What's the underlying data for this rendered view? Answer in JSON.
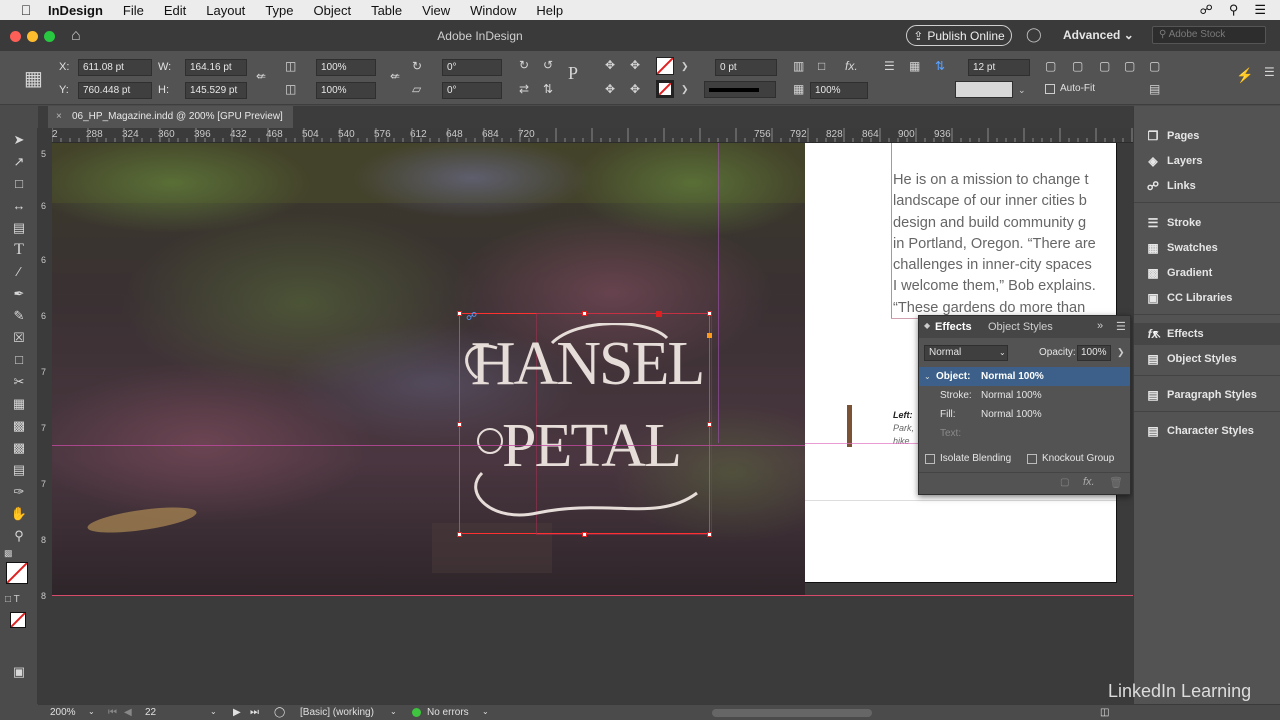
{
  "menubar": {
    "app": "InDesign",
    "items": [
      "File",
      "Edit",
      "Layout",
      "Type",
      "Object",
      "Table",
      "View",
      "Window",
      "Help"
    ]
  },
  "window": {
    "title": "Adobe InDesign",
    "publish_label": "Publish Online",
    "workspace": "Advanced",
    "search_placeholder": "Adobe Stock"
  },
  "control": {
    "x_label": "X:",
    "x_value": "611.08 pt",
    "y_label": "Y:",
    "y_value": "760.448 pt",
    "w_label": "W:",
    "w_value": "164.16 pt",
    "h_label": "H:",
    "h_value": "145.529 pt",
    "scale_x": "100%",
    "scale_y": "100%",
    "rotate": "0°",
    "shear": "0°",
    "stroke_weight": "0 pt",
    "opacity": "100%",
    "spacing": "12 pt",
    "autofit_label": "Auto-Fit"
  },
  "doc_tab": {
    "title": "06_HP_Magazine.indd @ 200% [GPU Preview]"
  },
  "ruler": {
    "h_ticks": [
      "2",
      "288",
      "324",
      "360",
      "396",
      "432",
      "468",
      "504",
      "540",
      "576",
      "612",
      "648",
      "684",
      "720",
      "756",
      "792",
      "828",
      "864",
      "900",
      "936"
    ],
    "v_ticks": [
      "5",
      "6",
      "6",
      "6",
      "7",
      "7",
      "7",
      "8",
      "8"
    ]
  },
  "artwork": {
    "line1": "HANSEL",
    "line2": "PETAL"
  },
  "page": {
    "body_lines": [
      "He is on a mission to change t",
      "landscape of our inner cities b",
      "design and build community g",
      "in Portland, Oregon. “There are",
      "challenges in inner-city spaces",
      "I welcome them,” Bob explains.",
      "“These gardens do more than"
    ],
    "caption_bold": "Left:",
    "caption_line2": "Park,",
    "caption_line3": "hike"
  },
  "effects_panel": {
    "tab_active": "Effects",
    "tab_other": "Object Styles",
    "blend_mode": "Normal",
    "opacity_label": "Opacity:",
    "opacity_value": "100%",
    "rows": [
      {
        "label": "Object:",
        "value": "Normal 100%"
      },
      {
        "label": "Stroke:",
        "value": "Normal 100%"
      },
      {
        "label": "Fill:",
        "value": "Normal 100%"
      },
      {
        "label": "Text:",
        "value": ""
      }
    ],
    "isolate_label": "Isolate Blending",
    "knockout_label": "Knockout Group"
  },
  "dock": {
    "items": [
      "Pages",
      "Layers",
      "Links",
      "Stroke",
      "Swatches",
      "Gradient",
      "CC Libraries",
      "Effects",
      "Object Styles",
      "Paragraph Styles",
      "Character Styles"
    ]
  },
  "status": {
    "zoom": "200%",
    "page": "22",
    "profile": "[Basic] (working)",
    "preflight": "No errors"
  },
  "watermark": {
    "text": "LinkedIn Learning"
  }
}
